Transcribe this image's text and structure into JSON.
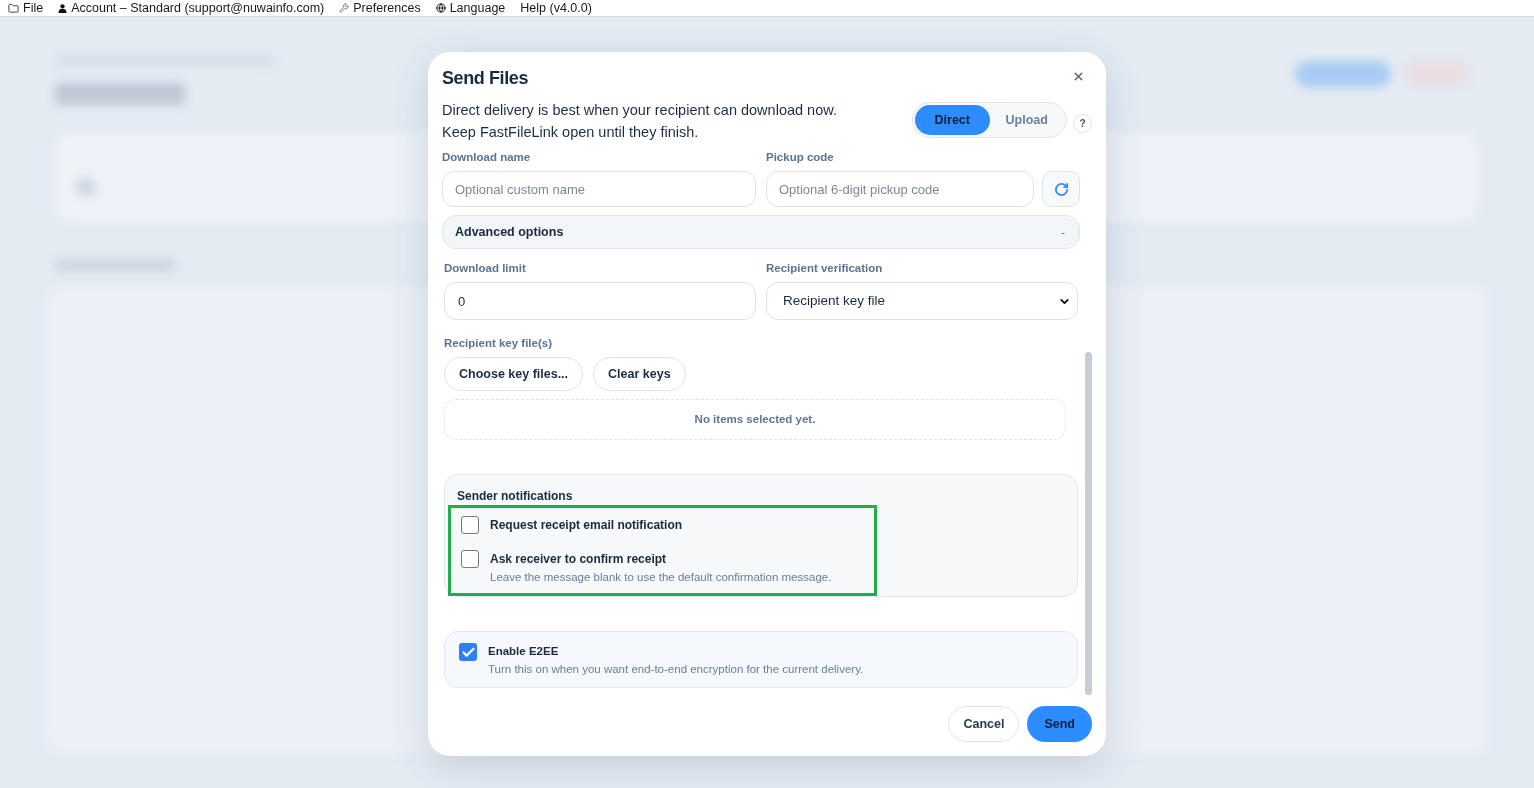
{
  "menu_bar": {
    "items": [
      {
        "label": "File"
      },
      {
        "label": "Account – Standard (support@nuwainfo.com)"
      },
      {
        "label": "Preferences"
      },
      {
        "label": "Language"
      },
      {
        "label": "Help (v4.0.0)"
      }
    ]
  },
  "dialog": {
    "title": "Send Files",
    "description": "Direct delivery is best when your recipient can download now.\nKeep FastFileLink open until they finish.",
    "modes": [
      {
        "label": "Direct",
        "selected": true
      },
      {
        "label": "Upload",
        "selected": false
      }
    ],
    "help": "?",
    "download_name": {
      "label": "Download name",
      "placeholder": "Optional custom name"
    },
    "pickup_code": {
      "label": "Pickup code",
      "placeholder": "Optional 6-digit pickup code"
    },
    "advanced_options": {
      "label": "Advanced options",
      "toggle": "-",
      "expanded": true
    },
    "download_limit": {
      "label": "Download limit",
      "value": "0"
    },
    "recipient_verification": {
      "label": "Recipient verification",
      "value": "Recipient key file"
    },
    "key_files": {
      "label": "Recipient key file(s)",
      "buttons": [
        "Choose key files...",
        "Clear keys"
      ],
      "empty_text": "No items selected yet."
    },
    "sender_notifications": {
      "title": "Sender notifications",
      "highlighted": true,
      "options": [
        {
          "label": "Request receipt email notification",
          "checked": false
        },
        {
          "label": "Ask receiver to confirm receipt",
          "hint": "Leave the message blank to use the default confirmation message.",
          "checked": false
        }
      ]
    },
    "e2ee": {
      "label": "Enable E2EE",
      "hint": "Turn this on when you want end-to-end encryption for the current delivery.",
      "checked": true
    },
    "buttons": [
      {
        "label": "Cancel",
        "kind": "secondary"
      },
      {
        "label": "Send",
        "kind": "primary"
      }
    ]
  }
}
